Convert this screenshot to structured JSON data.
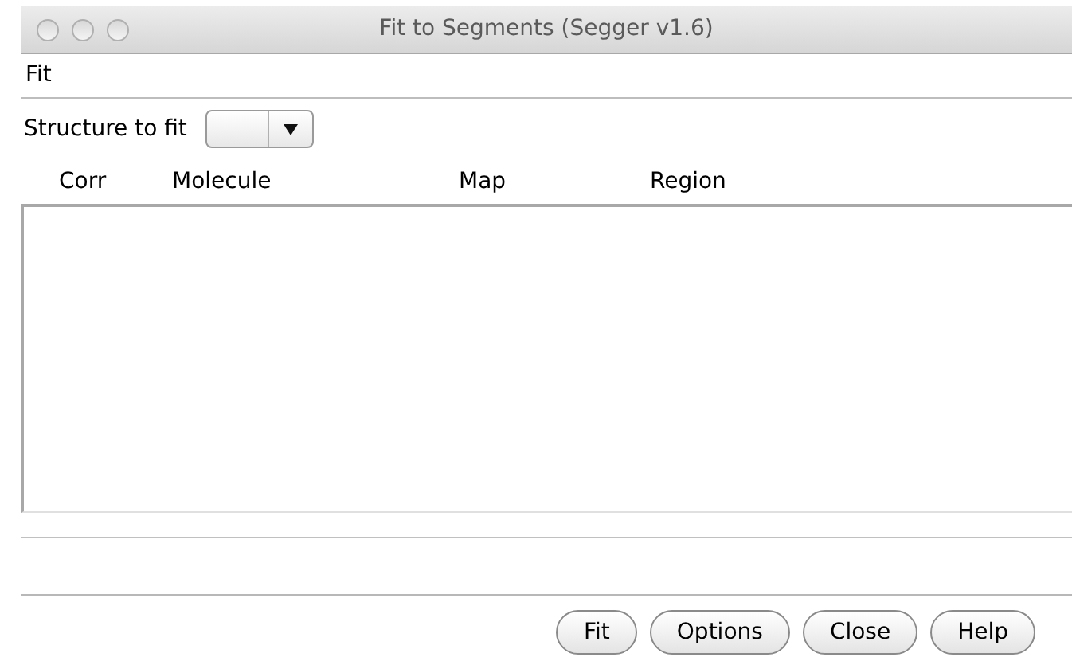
{
  "window": {
    "title": "Fit to Segments (Segger v1.6)"
  },
  "menu": [
    "Fit"
  ],
  "structure_field": {
    "label": "Structure to fit"
  },
  "table": {
    "columns": [
      "Corr",
      "Molecule",
      "Map",
      "Region"
    ]
  },
  "buttons": [
    "Fit",
    "Options",
    "Close",
    "Help"
  ]
}
